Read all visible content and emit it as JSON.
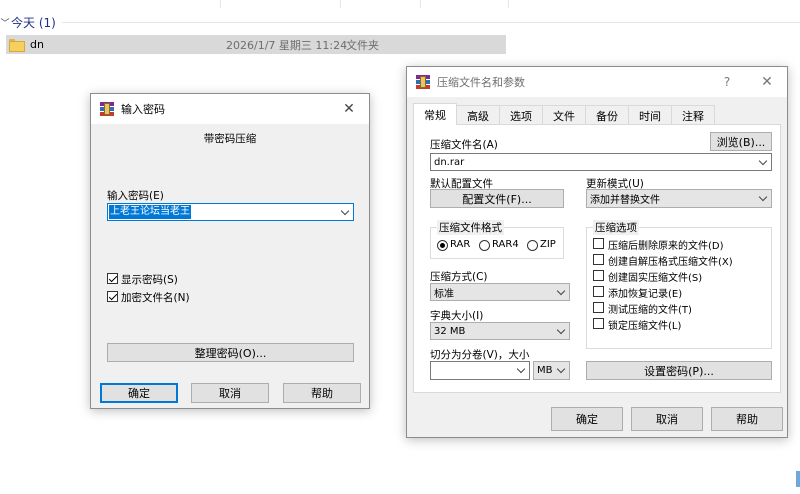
{
  "explorer": {
    "group_label": "今天 (1)",
    "file": {
      "name": "dn",
      "date": "2026/1/7 星期三 11:24",
      "type": "文件夹"
    }
  },
  "password_dialog": {
    "title": "输入密码",
    "subtitle": "带密码压缩",
    "password_label": "输入密码(E)",
    "password_value": "上老王论坛当老王",
    "show_password_label": "显示密码(S)",
    "show_password_checked": true,
    "encrypt_names_label": "加密文件名(N)",
    "encrypt_names_checked": true,
    "organize_button": "整理密码(O)...",
    "ok_button": "确定",
    "cancel_button": "取消",
    "help_button": "帮助"
  },
  "archive_dialog": {
    "title": "压缩文件名和参数",
    "help_glyph": "?",
    "tabs": [
      "常规",
      "高级",
      "选项",
      "文件",
      "备份",
      "时间",
      "注释"
    ],
    "active_tab": "常规",
    "archive_name_label": "压缩文件名(A)",
    "browse_button": "浏览(B)...",
    "archive_name_value": "dn.rar",
    "default_profile_label": "默认配置文件",
    "profile_button": "配置文件(F)...",
    "update_mode_label": "更新模式(U)",
    "update_mode_value": "添加并替换文件",
    "format_group_label": "压缩文件格式",
    "formats": [
      "RAR",
      "RAR4",
      "ZIP"
    ],
    "selected_format": "RAR",
    "method_label": "压缩方式(C)",
    "method_value": "标准",
    "dict_label": "字典大小(I)",
    "dict_value": "32 MB",
    "split_label": "切分为分卷(V)，大小",
    "split_value": "",
    "split_unit": "MB",
    "options_group_label": "压缩选项",
    "options": [
      "压缩后删除原来的文件(D)",
      "创建自解压格式压缩文件(X)",
      "创建固实压缩文件(S)",
      "添加恢复记录(E)",
      "测试压缩的文件(T)",
      "锁定压缩文件(L)"
    ],
    "set_password_button": "设置密码(P)...",
    "ok_button": "确定",
    "cancel_button": "取消",
    "help_button": "帮助"
  },
  "colors": {
    "accent": "#0078d7",
    "selection": "#0078d7",
    "folder": "#f6cf5e"
  }
}
